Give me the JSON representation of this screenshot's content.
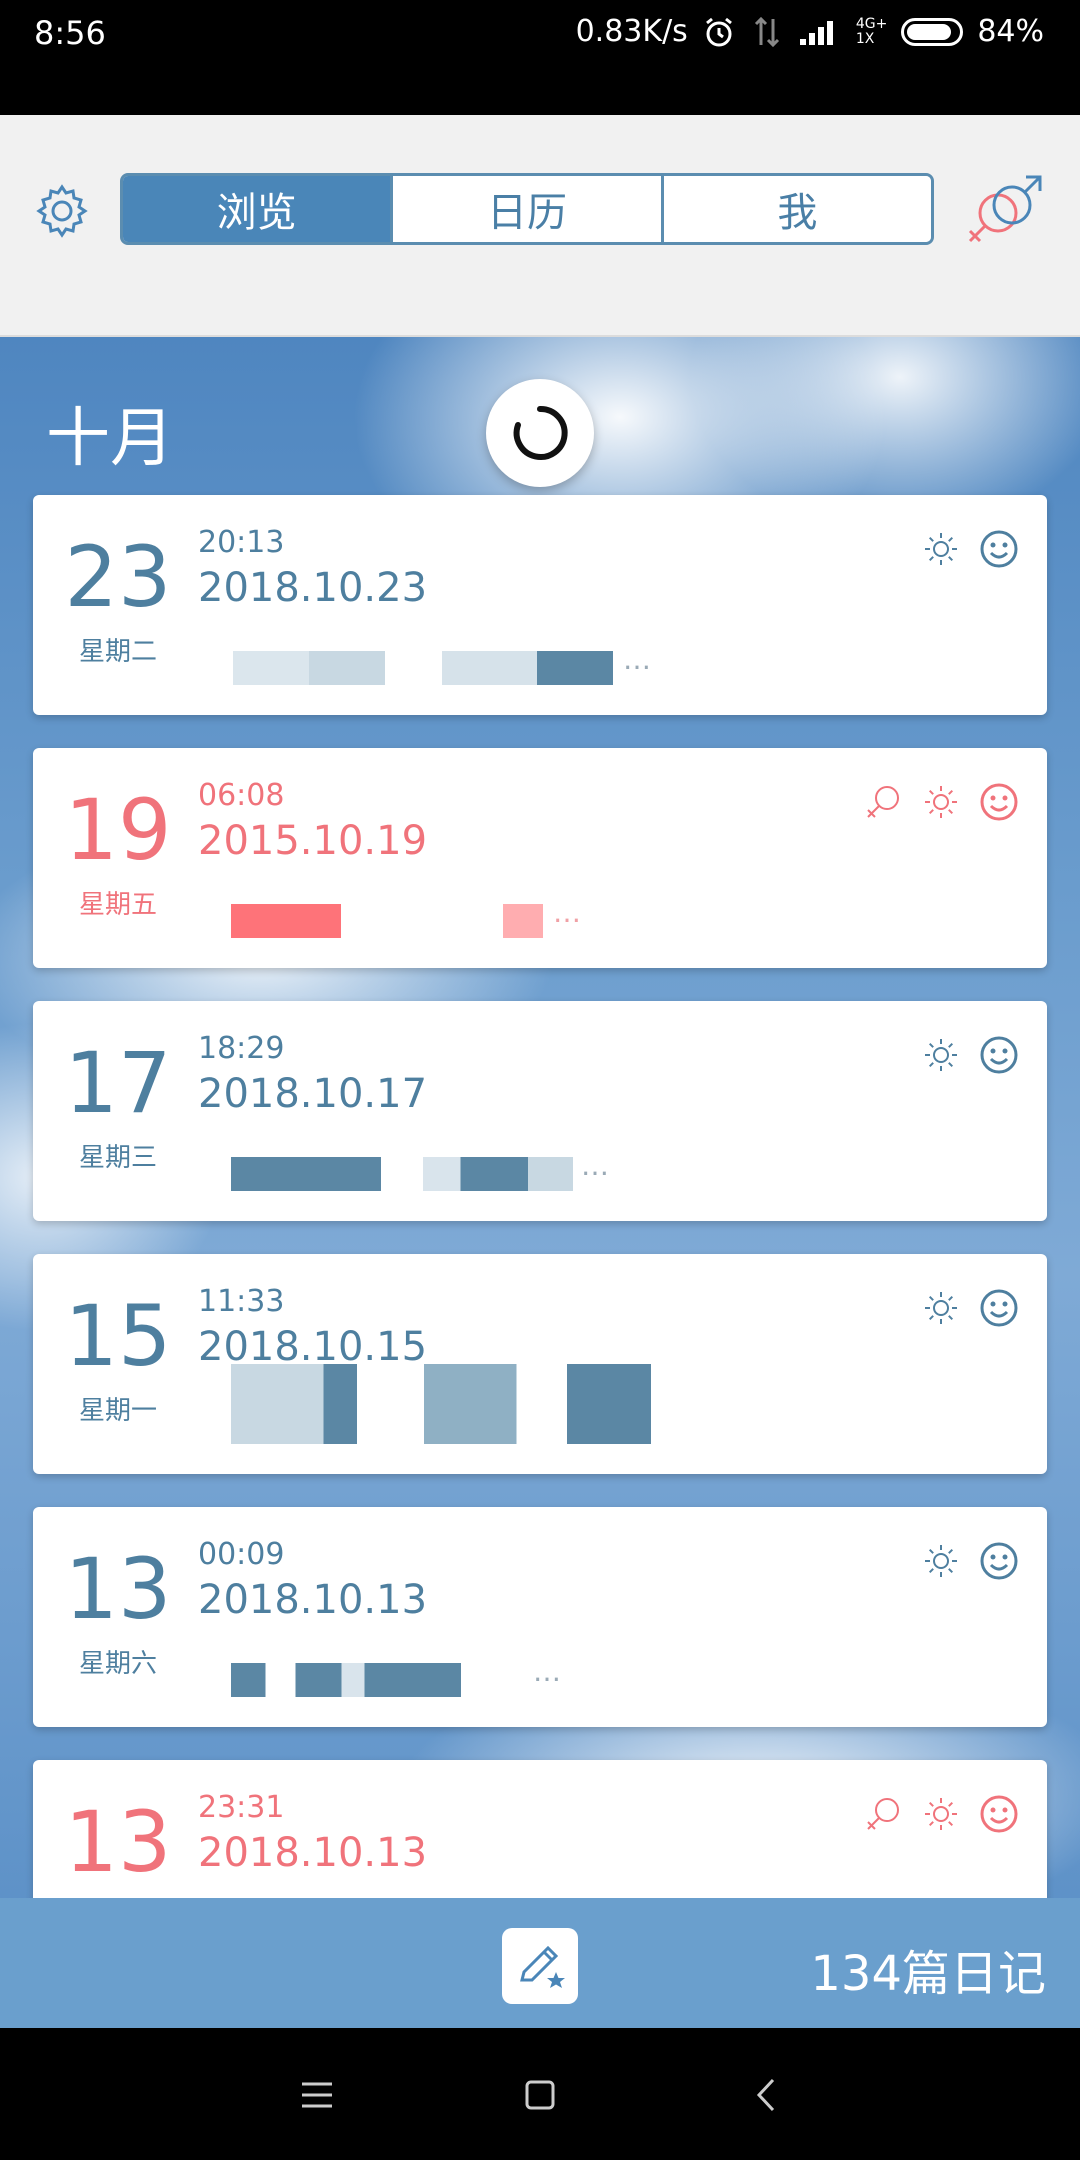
{
  "status_bar": {
    "time": "8:56",
    "net_speed": "0.83K/s",
    "network_label": "4G+",
    "sim_label": "1X",
    "battery": "84%"
  },
  "header": {
    "tabs": [
      {
        "label": "浏览",
        "active": true
      },
      {
        "label": "日历",
        "active": false
      },
      {
        "label": "我",
        "active": false
      }
    ],
    "settings_icon": "gear-icon",
    "gender_icon": "gender-icon"
  },
  "main": {
    "month_title": "十月",
    "entries": [
      {
        "day": "23",
        "weekday": "星期二",
        "time": "20:13",
        "date": "2018.10.23",
        "preview": "…",
        "color": "#4e7f9f",
        "icons": [
          "sun-icon",
          "smiley-icon"
        ]
      },
      {
        "day": "19",
        "weekday": "星期五",
        "time": "06:08",
        "date": "2015.10.19",
        "preview": "…",
        "color": "#f0737b",
        "icons": [
          "female-icon",
          "sun-icon",
          "smiley-icon"
        ]
      },
      {
        "day": "17",
        "weekday": "星期三",
        "time": "18:29",
        "date": "2018.10.17",
        "preview": "…",
        "color": "#4e7f9f",
        "icons": [
          "sun-icon",
          "smiley-icon"
        ]
      },
      {
        "day": "15",
        "weekday": "星期一",
        "time": "11:33",
        "date": "2018.10.15",
        "preview": "",
        "color": "#4e7f9f",
        "icons": [
          "sun-icon",
          "smiley-icon"
        ]
      },
      {
        "day": "13",
        "weekday": "星期六",
        "time": "00:09",
        "date": "2018.10.13",
        "preview": "…",
        "color": "#4e7f9f",
        "icons": [
          "sun-icon",
          "smiley-icon"
        ]
      },
      {
        "day": "13",
        "weekday": "",
        "time": "23:31",
        "date": "2018.10.13",
        "preview": "",
        "color": "#f0737b",
        "icons": [
          "female-icon",
          "sun-icon",
          "smiley-icon"
        ]
      }
    ]
  },
  "bottom_bar": {
    "diary_count": "134篇日记",
    "write_icon": "write-pencil-icon"
  },
  "nav_bar": {
    "icons": [
      "menu-icon",
      "home-icon",
      "back-icon"
    ]
  }
}
